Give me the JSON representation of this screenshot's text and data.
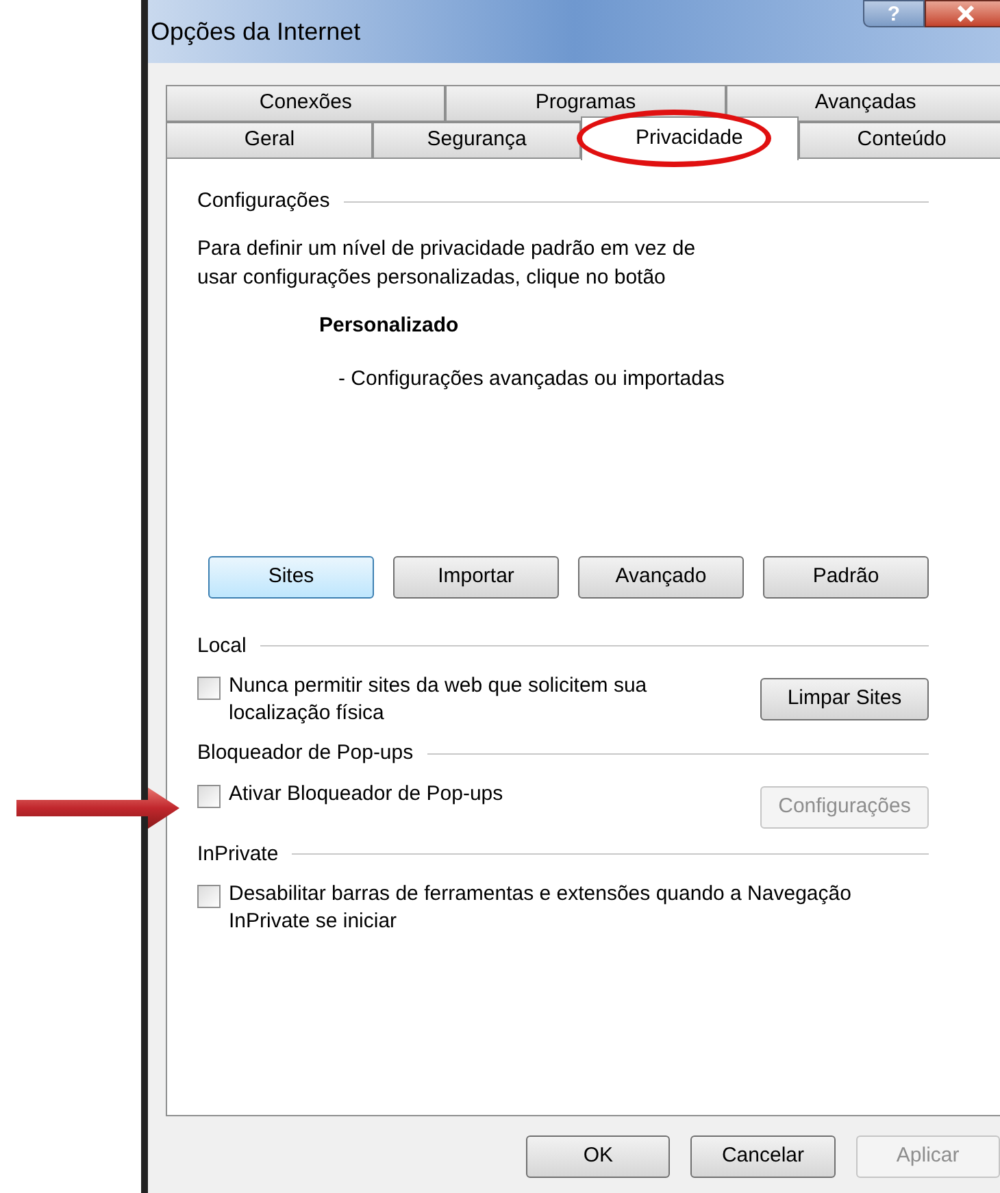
{
  "window": {
    "title": "Opções da Internet",
    "help_button": "?"
  },
  "tabs": [
    [
      {
        "label": "Conexões",
        "selected": false
      },
      {
        "label": "Programas",
        "selected": false
      },
      {
        "label": "Avançadas",
        "selected": false
      }
    ],
    [
      {
        "label": "Geral",
        "selected": false
      },
      {
        "label": "Segurança",
        "selected": false
      },
      {
        "label": "Privacidade",
        "selected": true
      },
      {
        "label": "Conteúdo",
        "selected": false
      }
    ]
  ],
  "settings": {
    "heading": "Configurações",
    "description": "Para definir um nível de privacidade padrão em vez de usar configurações personalizadas, clique no botão",
    "level_name": "Personalizado",
    "level_description": "- Configurações avançadas ou importadas",
    "buttons": [
      {
        "label": "Sites",
        "focused": true,
        "disabled": false
      },
      {
        "label": "Importar",
        "focused": false,
        "disabled": false
      },
      {
        "label": "Avançado",
        "focused": false,
        "disabled": false
      },
      {
        "label": "Padrão",
        "focused": false,
        "disabled": false
      }
    ]
  },
  "sections": [
    {
      "heading": "Local",
      "checkbox": {
        "label": "Nunca permitir sites da web que solicitem sua localização física",
        "checked": false
      },
      "button": {
        "label": "Limpar Sites",
        "disabled": false
      }
    },
    {
      "heading": "Bloqueador de Pop-ups",
      "checkbox": {
        "label": "Ativar Bloqueador de Pop-ups",
        "checked": false
      },
      "button": {
        "label": "Configurações",
        "disabled": true
      }
    },
    {
      "heading": "InPrivate",
      "checkbox": {
        "label": "Desabilitar barras de ferramentas e extensões quando a Navegação InPrivate se iniciar",
        "checked": false
      }
    }
  ],
  "footer_buttons": [
    {
      "label": "OK",
      "disabled": false
    },
    {
      "label": "Cancelar",
      "disabled": false
    },
    {
      "label": "Aplicar",
      "disabled": true
    }
  ]
}
